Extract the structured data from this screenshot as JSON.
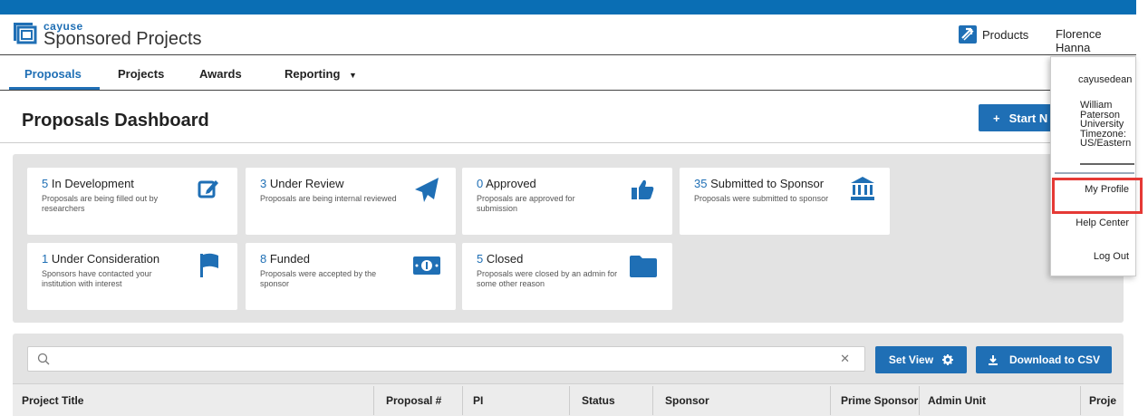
{
  "app": {
    "brand_small": "cayuse",
    "brand_name": "Sponsored Projects",
    "products_label": "Products",
    "user_name": "Florence Hanna",
    "brand_color": "#1f6fb5"
  },
  "nav": {
    "tabs": [
      {
        "label": "Proposals",
        "active": true
      },
      {
        "label": "Projects",
        "active": false
      },
      {
        "label": "Awards",
        "active": false
      },
      {
        "label": "Reporting",
        "active": false
      }
    ]
  },
  "page": {
    "title": "Proposals Dashboard",
    "start_button": "Start N"
  },
  "status_cards": [
    {
      "count": "5",
      "title": "In Development",
      "desc": "Proposals are being filled out by researchers",
      "icon": "edit-icon"
    },
    {
      "count": "3",
      "title": "Under Review",
      "desc": "Proposals are being internal reviewed",
      "icon": "paper-plane-icon"
    },
    {
      "count": "0",
      "title": "Approved",
      "desc": "Proposals are approved for submission",
      "icon": "thumbs-up-icon"
    },
    {
      "count": "35",
      "title": "Submitted to Sponsor",
      "desc": "Proposals were submitted to sponsor",
      "icon": "institution-icon"
    },
    {
      "count": "1",
      "title": "Under Consideration",
      "desc": "Sponsors have contacted your institution with interest",
      "icon": "flag-icon"
    },
    {
      "count": "8",
      "title": "Funded",
      "desc": "Proposals were accepted by the sponsor",
      "icon": "money-icon"
    },
    {
      "count": "5",
      "title": "Closed",
      "desc": "Proposals were closed by an admin for some other reason",
      "icon": "folder-icon"
    }
  ],
  "search": {
    "value": "",
    "placeholder": "",
    "set_view_label": "Set View",
    "download_label": "Download to CSV"
  },
  "table": {
    "columns": [
      "Project Title",
      "Proposal #",
      "PI",
      "Status",
      "Sponsor",
      "Prime Sponsor",
      "Admin Unit",
      "Proje"
    ]
  },
  "user_menu": {
    "username": "cayusedean",
    "org": "William Paterson University Timezone: US/Eastern",
    "items": [
      "My Profile",
      "Help Center",
      "Log Out"
    ]
  }
}
